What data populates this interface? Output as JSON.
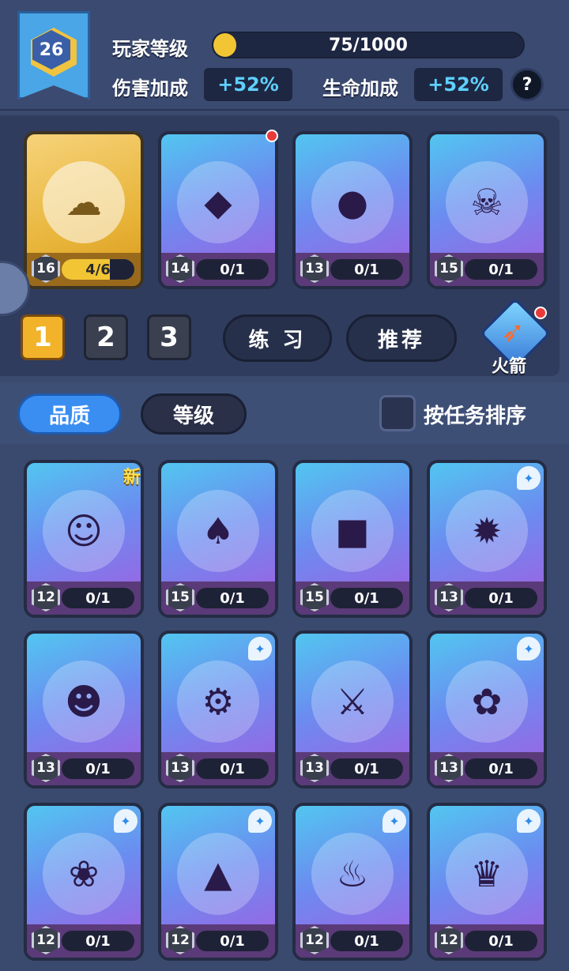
{
  "header": {
    "player_level": "26",
    "player_level_label": "玩家等级",
    "xp_text": "75/1000",
    "xp_progress": 0.075,
    "damage_bonus_label": "伤害加成",
    "damage_bonus_value": "+52%",
    "hp_bonus_label": "生命加成",
    "hp_bonus_value": "+52%",
    "help_label": "?"
  },
  "team": [
    {
      "level": "16",
      "progress_text": "4/6",
      "progress": 0.667,
      "rarity": "gold",
      "icon": "cloud-spirit-icon",
      "glyph": "☁",
      "red_dot": false
    },
    {
      "level": "14",
      "progress_text": "0/1",
      "progress": 0,
      "rarity": "purple",
      "icon": "green-ninja-icon",
      "glyph": "◆",
      "red_dot": true
    },
    {
      "level": "13",
      "progress_text": "0/1",
      "progress": 0,
      "rarity": "purple",
      "icon": "red-fox-chef-icon",
      "glyph": "●",
      "red_dot": false
    },
    {
      "level": "15",
      "progress_text": "0/1",
      "progress": 0,
      "rarity": "purple",
      "icon": "pirate-captain-icon",
      "glyph": "☠",
      "red_dot": false
    }
  ],
  "team_slots": [
    "1",
    "2",
    "3"
  ],
  "active_slot": "1",
  "practice_label": "练 习",
  "recommend_label": "推荐",
  "rocket_label": "火箭",
  "filter": {
    "tab_quality": "品质",
    "tab_level": "等级",
    "sort_by_task_label": "按任务排序"
  },
  "heroes": [
    {
      "level": "12",
      "progress_text": "0/1",
      "icon": "monk-icon",
      "glyph": "☺",
      "badge": "新"
    },
    {
      "level": "15",
      "progress_text": "0/1",
      "icon": "witch-cat-icon",
      "glyph": "♠",
      "badge": ""
    },
    {
      "level": "15",
      "progress_text": "0/1",
      "icon": "stone-golem-icon",
      "glyph": "■",
      "badge": ""
    },
    {
      "level": "13",
      "progress_text": "0/1",
      "icon": "fire-demon-icon",
      "glyph": "✹",
      "badge": "fire-shield"
    },
    {
      "level": "13",
      "progress_text": "0/1",
      "icon": "purple-frog-icon",
      "glyph": "☻",
      "badge": ""
    },
    {
      "level": "13",
      "progress_text": "0/1",
      "icon": "robot-icon",
      "glyph": "⚙",
      "badge": "fire-shield"
    },
    {
      "level": "13",
      "progress_text": "0/1",
      "icon": "samurai-icon",
      "glyph": "⚔",
      "badge": ""
    },
    {
      "level": "13",
      "progress_text": "0/1",
      "icon": "panda-icon",
      "glyph": "✿",
      "badge": "fire-shield"
    },
    {
      "level": "12",
      "progress_text": "0/1",
      "icon": "princess-icon",
      "glyph": "❀",
      "badge": "fire-shield"
    },
    {
      "level": "12",
      "progress_text": "0/1",
      "icon": "anubis-icon",
      "glyph": "▲",
      "badge": "fire-shield"
    },
    {
      "level": "12",
      "progress_text": "0/1",
      "icon": "phoenix-icon",
      "glyph": "♨",
      "badge": "fire-shield"
    },
    {
      "level": "12",
      "progress_text": "0/1",
      "icon": "monkey-king-icon",
      "glyph": "♛",
      "badge": "fire-shield"
    }
  ],
  "colors": {
    "accent_blue": "#3a8ef2",
    "gold": "#f2c534",
    "bonus_text": "#5fd0ff",
    "card_gradient_top": "#52c6f0",
    "card_gradient_bottom": "#a55be0"
  }
}
